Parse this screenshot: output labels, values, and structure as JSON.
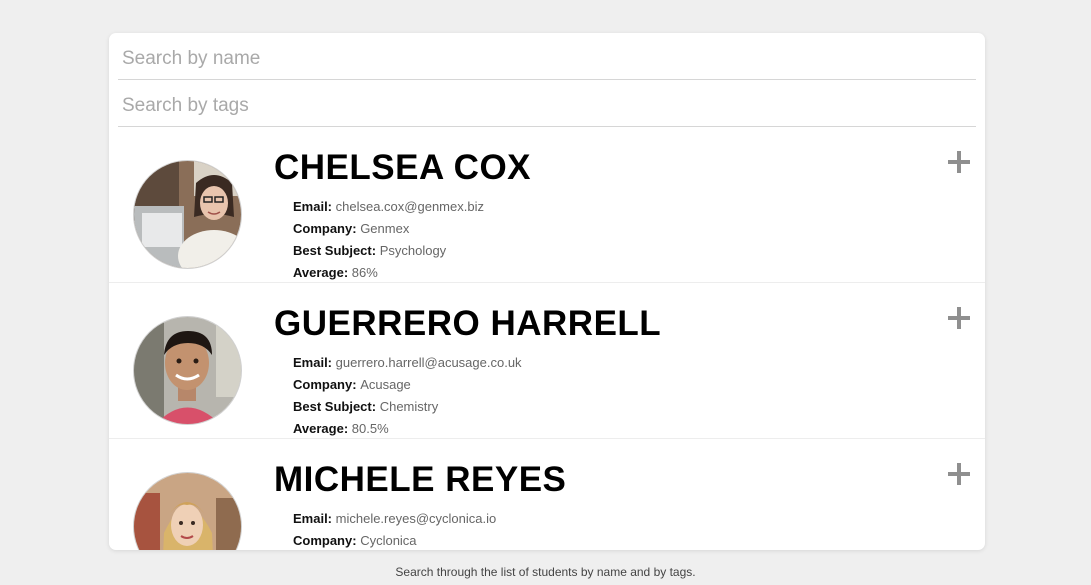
{
  "search": {
    "name_placeholder": "Search by name",
    "tags_placeholder": "Search by tags"
  },
  "labels": {
    "email": "Email:",
    "company": "Company:",
    "best_subject": "Best Subject:",
    "average": "Average:"
  },
  "students": [
    {
      "name": "CHELSEA COX",
      "email": "chelsea.cox@genmex.biz",
      "company": "Genmex",
      "best_subject": "Psychology",
      "average": "86%",
      "avatar_icon": "student-photo-icon"
    },
    {
      "name": "GUERRERO HARRELL",
      "email": "guerrero.harrell@acusage.co.uk",
      "company": "Acusage",
      "best_subject": "Chemistry",
      "average": "80.5%",
      "avatar_icon": "student-photo-icon"
    },
    {
      "name": "MICHELE REYES",
      "email": "michele.reyes@cyclonica.io",
      "company": "Cyclonica",
      "best_subject": "",
      "average": "",
      "avatar_icon": "student-photo-icon"
    }
  ],
  "expand_icon": "plus-icon",
  "footer_text": "Search through the list of students by name and by tags.",
  "colors": {
    "page_background": "#efefef",
    "card_background": "#ffffff",
    "expand_icon": "#8f8f8f"
  }
}
